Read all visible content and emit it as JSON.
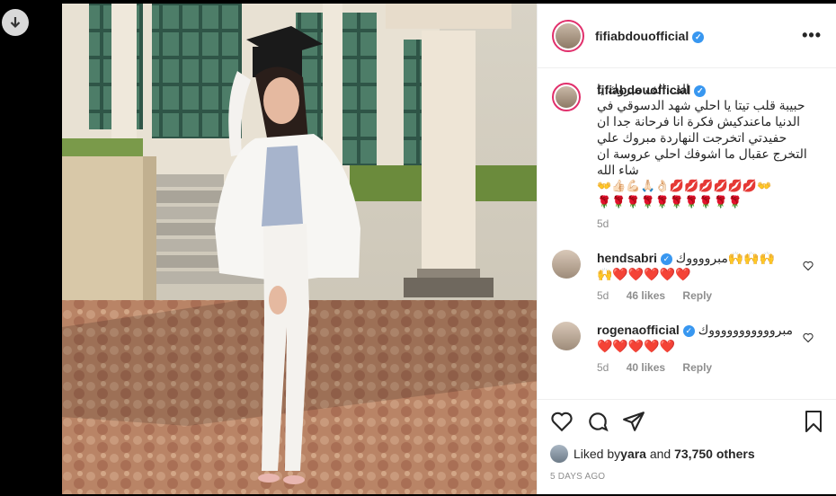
{
  "header": {
    "username": "fifiabdouofficial"
  },
  "caption": {
    "username": "fifiabdouofficial",
    "text": "الف الف مبروك يا\nحبيبة قلب تيتا يا احلي شهد الدسوقي في\nالدنيا ماعندكيش فكرة انا فرحانة جدا ان\nحفيدتي اتخرجت النهاردة مبروك علي\nالتخرج عقبال ما اشوفك احلي عروسة ان\nشاء الله",
    "emojis_line1": "👐💋💋💋💋💋💋👌🏻🙏🏻💪🏻👍🏻👐",
    "emojis_line2": "🌹🌹🌹🌹🌹🌹🌹🌹🌹🌹",
    "age": "5d"
  },
  "comments": [
    {
      "username": "hendsabri",
      "text": "مبرووووك🙌🙌🙌",
      "text2": "🙌❤️❤️❤️❤️❤️",
      "age": "5d",
      "likes": "46 likes",
      "reply": "Reply"
    },
    {
      "username": "rogenaofficial",
      "text": "مبروووووووووووك",
      "text2": "❤️❤️❤️❤️❤️",
      "age": "5d",
      "likes": "40 likes",
      "reply": "Reply"
    }
  ],
  "likes": {
    "liked_by": "Liked by ",
    "user": "yara",
    "and": " and ",
    "count": "73,750 others"
  },
  "date": "5 DAYS AGO",
  "colors": {
    "verified": "#3897f0",
    "ring": "#e1306c"
  }
}
